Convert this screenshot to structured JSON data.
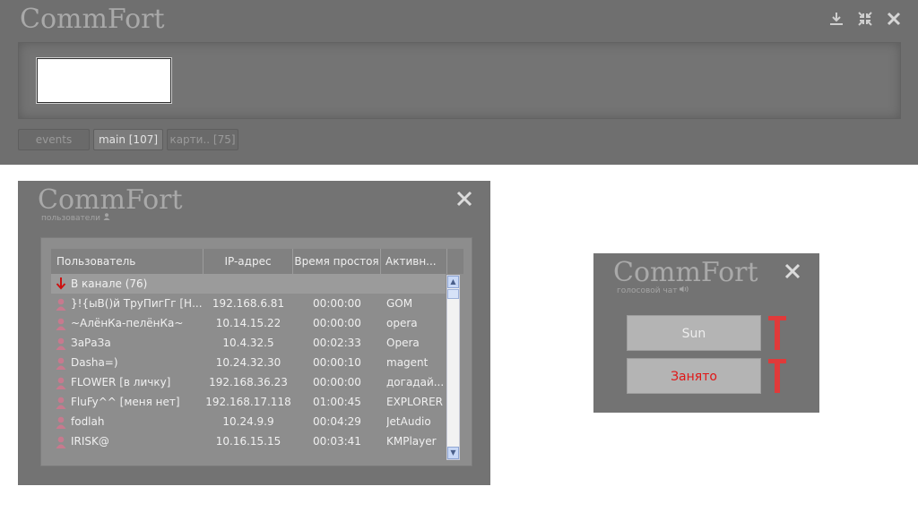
{
  "main_window": {
    "logo": "CommFort",
    "input_value": "",
    "tabs": [
      {
        "label": "events"
      },
      {
        "label": "main [107]"
      },
      {
        "label": "карти.. [75]"
      }
    ],
    "icons": {
      "download": "download-icon",
      "shrink": "shrink-icon",
      "close": "close-icon"
    }
  },
  "users_window": {
    "logo": "CommFort",
    "subtitle": "пользователи",
    "columns": [
      "Пользователь",
      "IP-адрес",
      "Время простоя",
      "Активн..."
    ],
    "group_label": "В канале (76)",
    "rows": [
      {
        "name": "}!{ыВ()й ТруПигГг [Н...",
        "ip": "192.168.6.81",
        "idle": "00:00:00",
        "activity": "GOM"
      },
      {
        "name": "~АлёнКа-пелёнКа~",
        "ip": "10.14.15.22",
        "idle": "00:00:00",
        "activity": "opera"
      },
      {
        "name": "ЗаРаЗа",
        "ip": "10.4.32.5",
        "idle": "00:02:33",
        "activity": "Opera"
      },
      {
        "name": "Dasha=)",
        "ip": "10.24.32.30",
        "idle": "00:00:10",
        "activity": "magent"
      },
      {
        "name": "FLOWER [в личку]",
        "ip": "192.168.36.23",
        "idle": "00:00:00",
        "activity": "догадай..."
      },
      {
        "name": "FluFy^^ [меня нет]",
        "ip": "192.168.17.118",
        "idle": "01:00:45",
        "activity": "EXPLORER"
      },
      {
        "name": "fodlah",
        "ip": "10.24.9.9",
        "idle": "00:04:29",
        "activity": "JetAudio"
      },
      {
        "name": "IRISK@",
        "ip": "10.16.15.15",
        "idle": "00:03:41",
        "activity": "KMPlayer"
      }
    ],
    "colors": {
      "user_icon": "#c77a8e",
      "group_arrow": "#cc1111"
    }
  },
  "voice_window": {
    "logo": "CommFort",
    "subtitle": "голосовой чат",
    "buttons": [
      {
        "label": "Sun",
        "color": "#ededed"
      },
      {
        "label": "Занято",
        "color": "#e01616"
      }
    ],
    "colors": {
      "mic": "#e03a3a"
    }
  }
}
